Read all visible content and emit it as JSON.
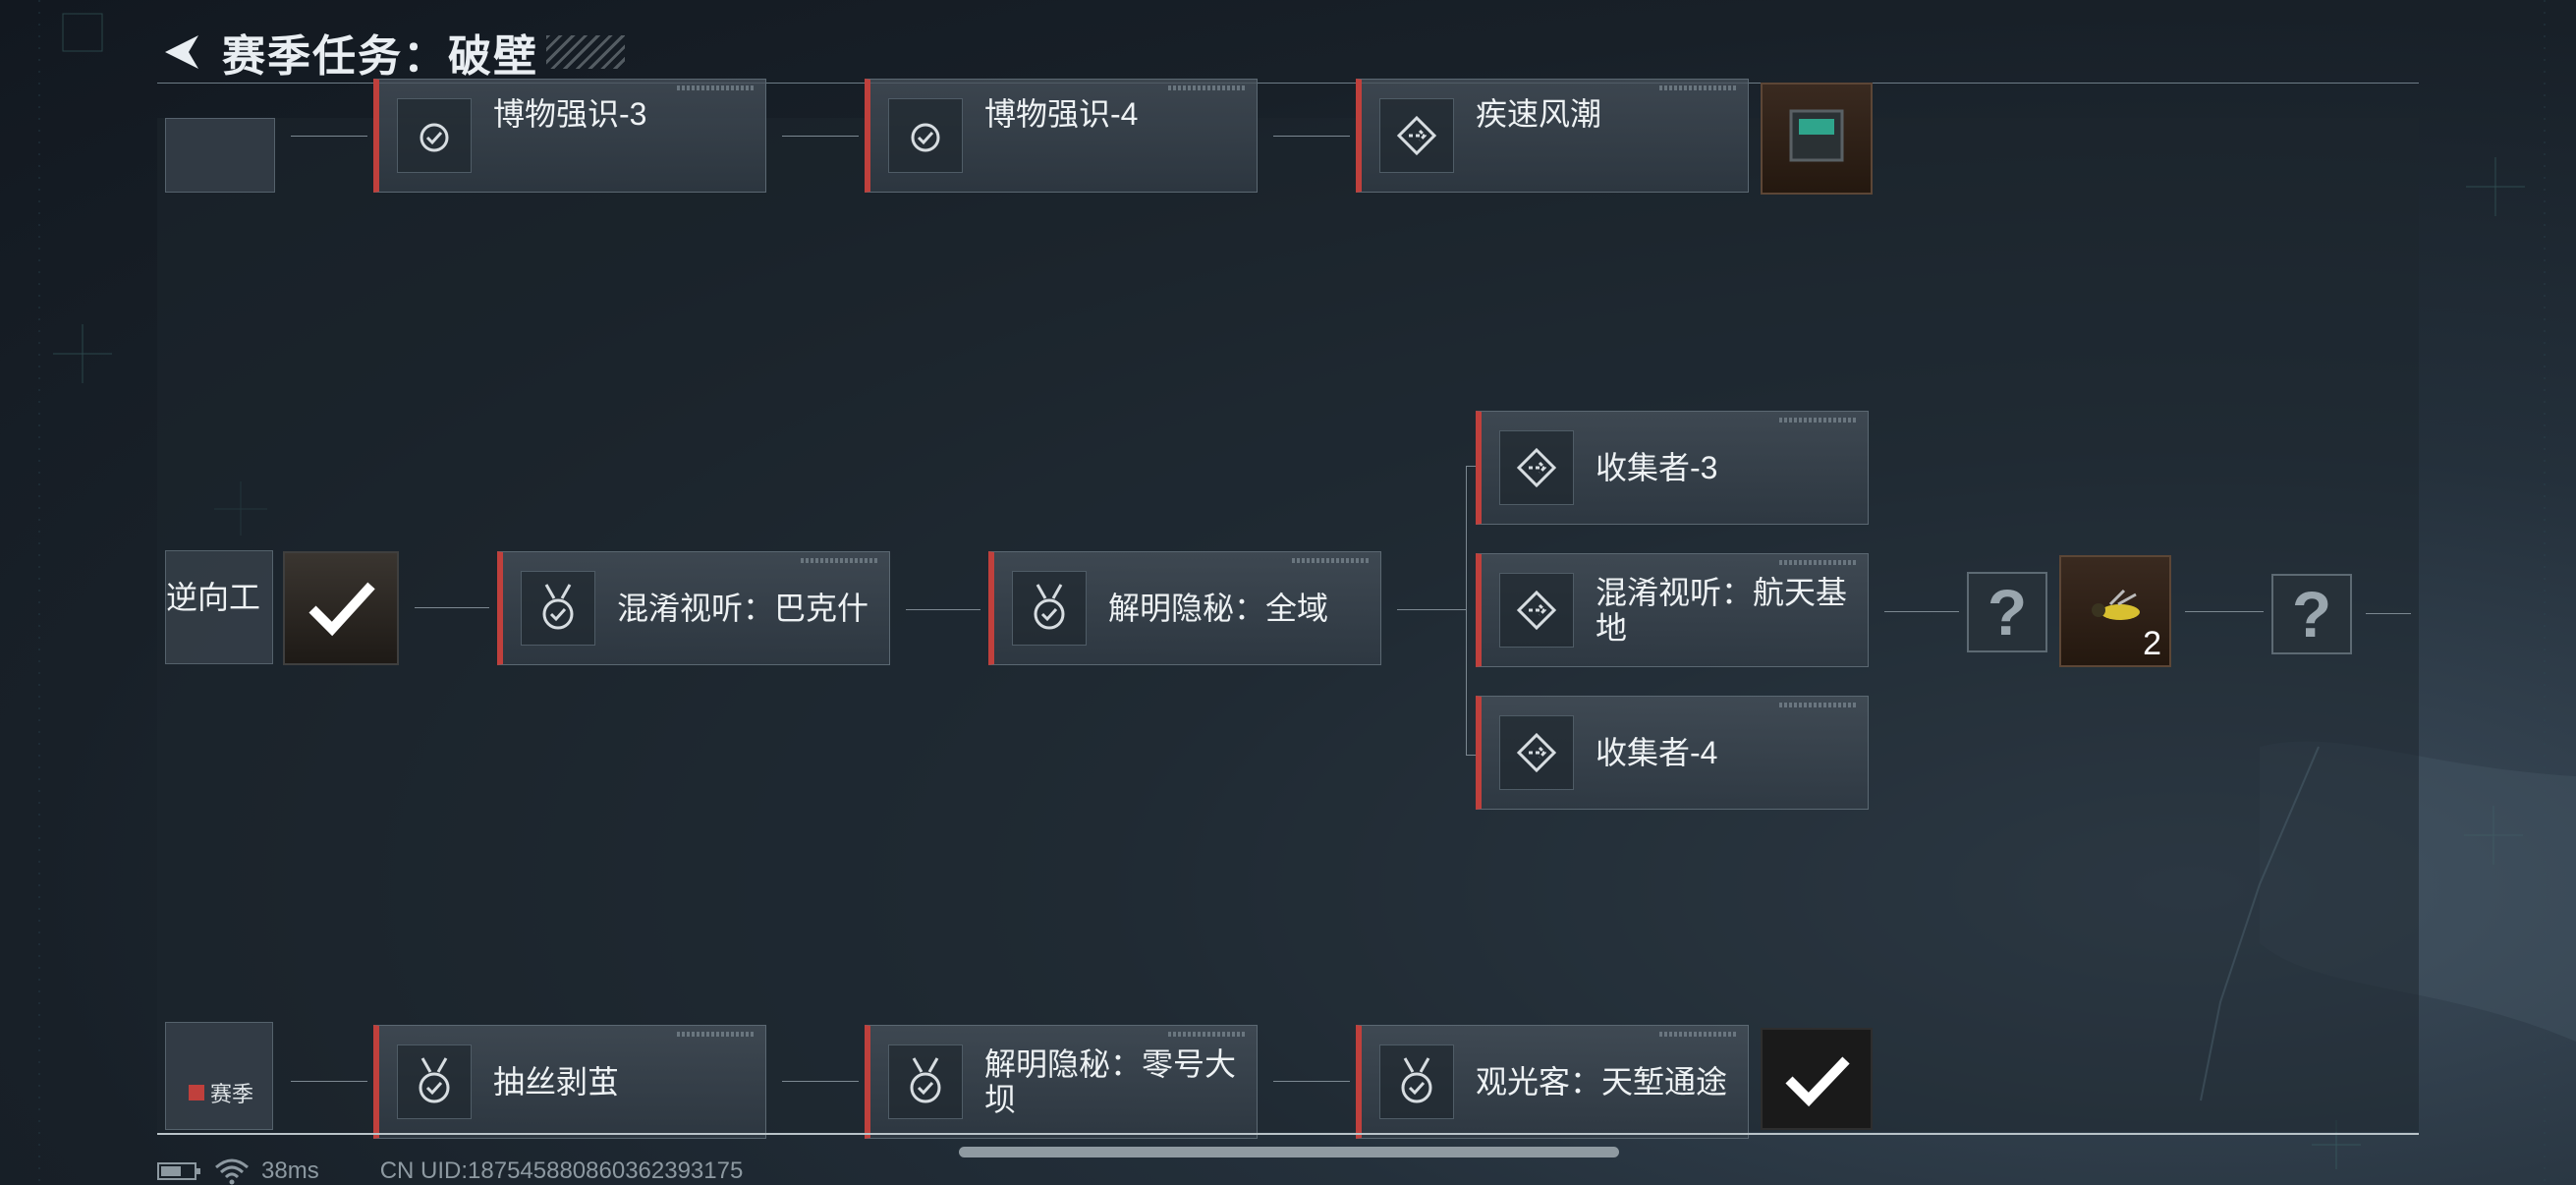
{
  "header": {
    "title": "赛季任务：破壁"
  },
  "tasks": {
    "top": [
      "博物强识-3",
      "博物强识-4",
      "疾速风潮"
    ],
    "middle_left_partial": "逆向工",
    "middle": [
      "混淆视听：巴克什",
      "解明隐秘：全域"
    ],
    "branch": [
      "收集者-3",
      "混淆视听：航天基地",
      "收集者-4"
    ],
    "bottom": [
      "抽丝剥茧",
      "解明隐秘：零号大坝",
      "观光客：天堑通途"
    ]
  },
  "bottom_left_badge": "赛季",
  "rewards": {
    "unknown": "?",
    "item_count": "2"
  },
  "status_bar": {
    "ping": "38ms",
    "uid": "CN UID:187545880860362393175"
  },
  "colors": {
    "accent": "#c0403c",
    "background": "#1b232b"
  }
}
